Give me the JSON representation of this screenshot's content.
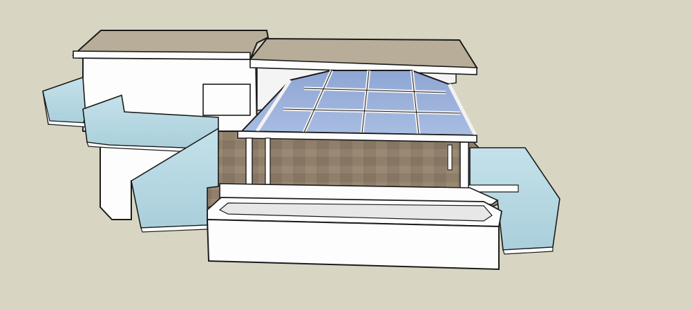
{
  "scene": {
    "description_text": "",
    "colors": {
      "background": "#d8d6c3",
      "roof": "#b8ad98",
      "wall": "#fdfdfd",
      "glass": "#b8d8e2",
      "skylight_glass": "#9fb5db",
      "floor": "#8f7f6b",
      "outline": "#1a1a1a"
    }
  }
}
